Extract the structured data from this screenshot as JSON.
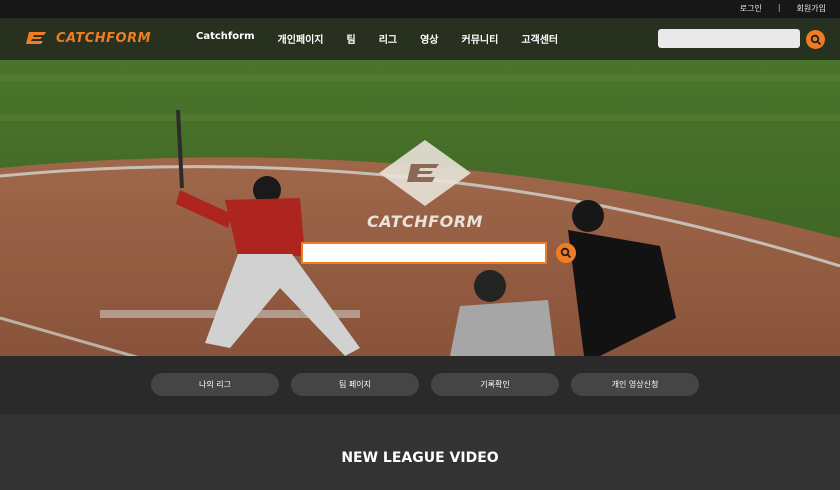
{
  "top_links": {
    "login": "로그인",
    "separator": "|",
    "signup": "회원가입"
  },
  "brand": {
    "name": "CATCHFORM",
    "accent": "#f07d22"
  },
  "nav": {
    "items": [
      "Catchform",
      "개인페이지",
      "팀",
      "리그",
      "영상",
      "커뮤니티",
      "고객센터"
    ],
    "search_placeholder": ""
  },
  "hero": {
    "brand_name": "CATCHFORM",
    "search_placeholder": ""
  },
  "quick_buttons": [
    "나의 리그",
    "팀 페이지",
    "기록확인",
    "개인 영상신청"
  ],
  "section": {
    "title": "NEW LEAGUE VIDEO"
  },
  "icons": {
    "search": "search-icon",
    "logo": "catchform-logo-icon"
  }
}
